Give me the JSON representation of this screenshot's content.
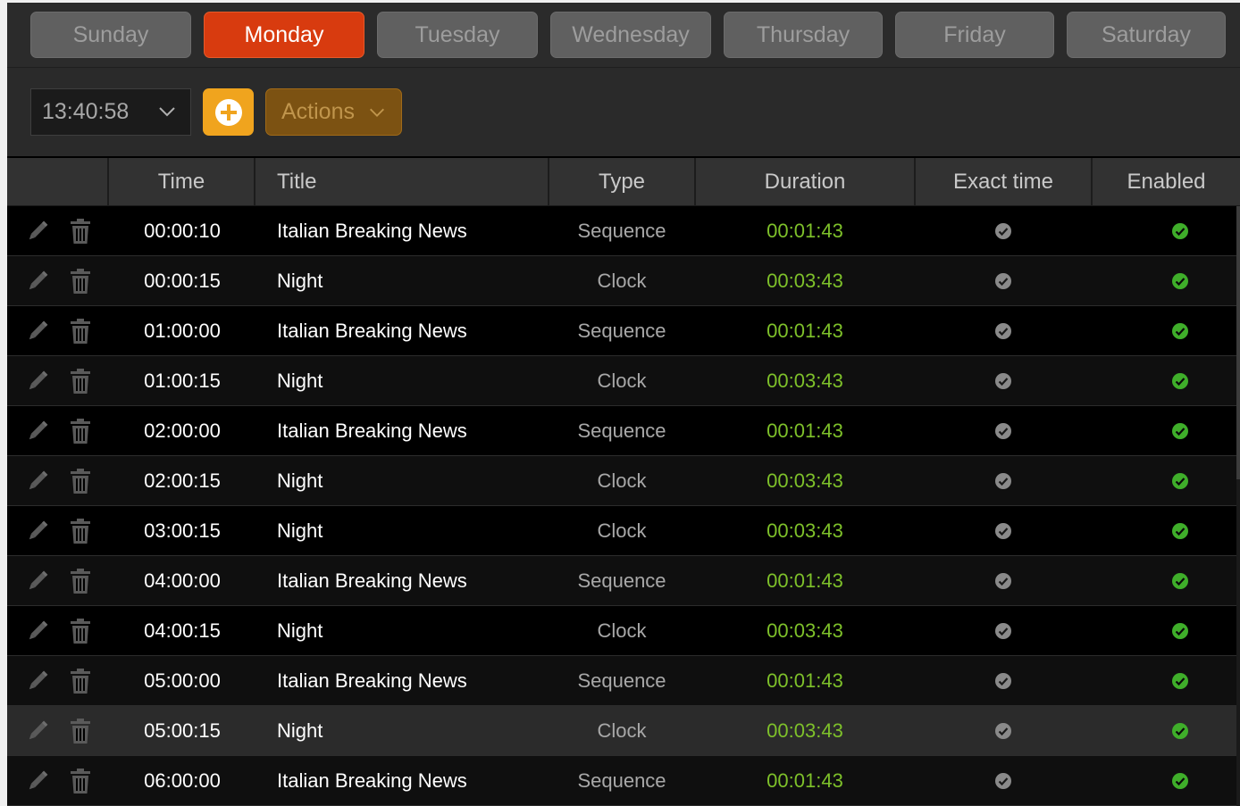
{
  "days": [
    {
      "label": "Sunday"
    },
    {
      "label": "Monday"
    },
    {
      "label": "Tuesday"
    },
    {
      "label": "Wednesday"
    },
    {
      "label": "Thursday"
    },
    {
      "label": "Friday"
    },
    {
      "label": "Saturday"
    }
  ],
  "active_day": "Monday",
  "toolbar": {
    "time_value": "13:40:58",
    "actions_label": "Actions"
  },
  "columns": {
    "time": "Time",
    "title": "Title",
    "type": "Type",
    "duration": "Duration",
    "exact_time": "Exact time",
    "enabled": "Enabled"
  },
  "colors": {
    "accent_active": "#d83b0f",
    "add_button": "#f0a41e",
    "actions_button": "#7c5212",
    "duration_text": "#7ec12a",
    "enabled_check": "#3fae2a",
    "exact_check": "#8a8a8a"
  },
  "icons": {
    "edit": "pencil-icon",
    "delete": "trash-icon",
    "add": "plus-circle-icon",
    "exact": "check-circle-icon",
    "enabled": "check-circle-icon"
  },
  "rows": [
    {
      "time": "00:00:10",
      "title": "Italian Breaking News",
      "type": "Sequence",
      "duration": "00:01:43",
      "exact_time": true,
      "enabled": true
    },
    {
      "time": "00:00:15",
      "title": "Night",
      "type": "Clock",
      "duration": "00:03:43",
      "exact_time": true,
      "enabled": true
    },
    {
      "time": "01:00:00",
      "title": "Italian Breaking News",
      "type": "Sequence",
      "duration": "00:01:43",
      "exact_time": true,
      "enabled": true
    },
    {
      "time": "01:00:15",
      "title": "Night",
      "type": "Clock",
      "duration": "00:03:43",
      "exact_time": true,
      "enabled": true
    },
    {
      "time": "02:00:00",
      "title": "Italian Breaking News",
      "type": "Sequence",
      "duration": "00:01:43",
      "exact_time": true,
      "enabled": true
    },
    {
      "time": "02:00:15",
      "title": "Night",
      "type": "Clock",
      "duration": "00:03:43",
      "exact_time": true,
      "enabled": true
    },
    {
      "time": "03:00:15",
      "title": "Night",
      "type": "Clock",
      "duration": "00:03:43",
      "exact_time": true,
      "enabled": true
    },
    {
      "time": "04:00:00",
      "title": "Italian Breaking News",
      "type": "Sequence",
      "duration": "00:01:43",
      "exact_time": true,
      "enabled": true
    },
    {
      "time": "04:00:15",
      "title": "Night",
      "type": "Clock",
      "duration": "00:03:43",
      "exact_time": true,
      "enabled": true
    },
    {
      "time": "05:00:00",
      "title": "Italian Breaking News",
      "type": "Sequence",
      "duration": "00:01:43",
      "exact_time": true,
      "enabled": true
    },
    {
      "time": "05:00:15",
      "title": "Night",
      "type": "Clock",
      "duration": "00:03:43",
      "exact_time": true,
      "enabled": true
    },
    {
      "time": "06:00:00",
      "title": "Italian Breaking News",
      "type": "Sequence",
      "duration": "00:01:43",
      "exact_time": true,
      "enabled": true
    }
  ]
}
